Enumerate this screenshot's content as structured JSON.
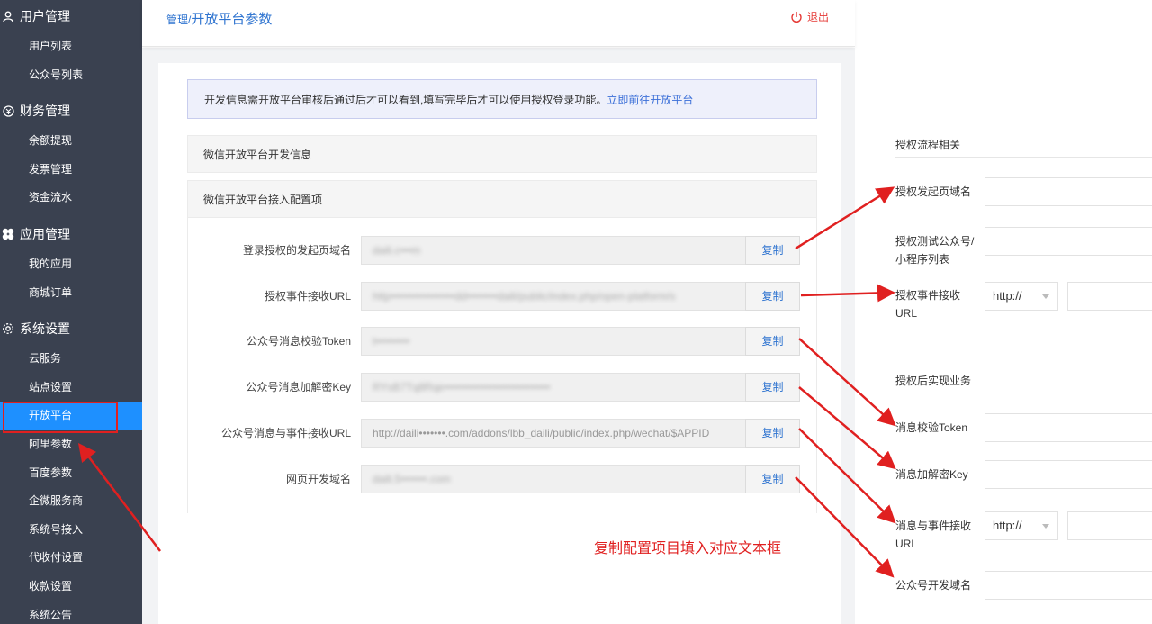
{
  "sidebar": {
    "groups": [
      {
        "title": "用户管理",
        "icon": "user-icon",
        "items": [
          "用户列表",
          "公众号列表"
        ]
      },
      {
        "title": "财务管理",
        "icon": "finance-icon",
        "items": [
          "余额提现",
          "发票管理",
          "资金流水"
        ]
      },
      {
        "title": "应用管理",
        "icon": "apps-icon",
        "items": [
          "我的应用",
          "商城订单"
        ]
      },
      {
        "title": "系统设置",
        "icon": "settings-icon",
        "items": [
          "云服务",
          "站点设置",
          "开放平台",
          "阿里参数",
          "百度参数",
          "企微服务商",
          "系统号接入",
          "代收付设置",
          "收款设置",
          "系统公告"
        ]
      }
    ],
    "active_item": "开放平台"
  },
  "header": {
    "breadcrumb_parent": "管理/",
    "breadcrumb_current": "开放平台参数",
    "logout_label": "退出"
  },
  "notice": {
    "text": "开发信息需开放平台审核后通过后才可以看到,填写完毕后才可以使用授权登录功能。",
    "link": "立即前往开放平台"
  },
  "sections": {
    "dev_info": "微信开放平台开发信息",
    "config": "微信开放平台接入配置项"
  },
  "config_rows": [
    {
      "label": "登录授权的发起页域名",
      "value": "daili.c•••m",
      "copy": "复制"
    },
    {
      "label": "授权事件接收URL",
      "value": "http•••••••••••••••••dd••••••••daili/public/index.php/open-platform/s",
      "copy": "复制"
    },
    {
      "label": "公众号消息校验Token",
      "value": "t•••••••••",
      "copy": "复制"
    },
    {
      "label": "公众号消息加解密Key",
      "value": "RYsB7Tq8Rqe••••••••••••••••••••••••••••",
      "copy": "复制"
    },
    {
      "label": "公众号消息与事件接收URL",
      "value": "http://daili•••••••.com/addons/lbb_daili/public/index.php/wechat/$APPID",
      "copy": "复制"
    },
    {
      "label": "网页开发域名",
      "value": "daili.5•••••••.com",
      "copy": "复制"
    }
  ],
  "annotation": "复制配置项目填入对应文本框",
  "right_panel": {
    "section1_title": "授权流程相关",
    "section2_title": "授权后实现业务",
    "fields": {
      "auth_domain": "授权发起页域名",
      "test_accounts": "授权测试公众号/小程序列表",
      "event_url": "授权事件接收URL",
      "token": "消息校验Token",
      "aes_key": "消息加解密Key",
      "msg_url": "消息与事件接收URL",
      "dev_domain": "公众号开发域名"
    },
    "protocol_select": "http://"
  },
  "colors": {
    "sidebar_bg": "#3a4150",
    "active_bg": "#1e90ff",
    "link": "#2f74d0",
    "annotation": "#e02020"
  }
}
